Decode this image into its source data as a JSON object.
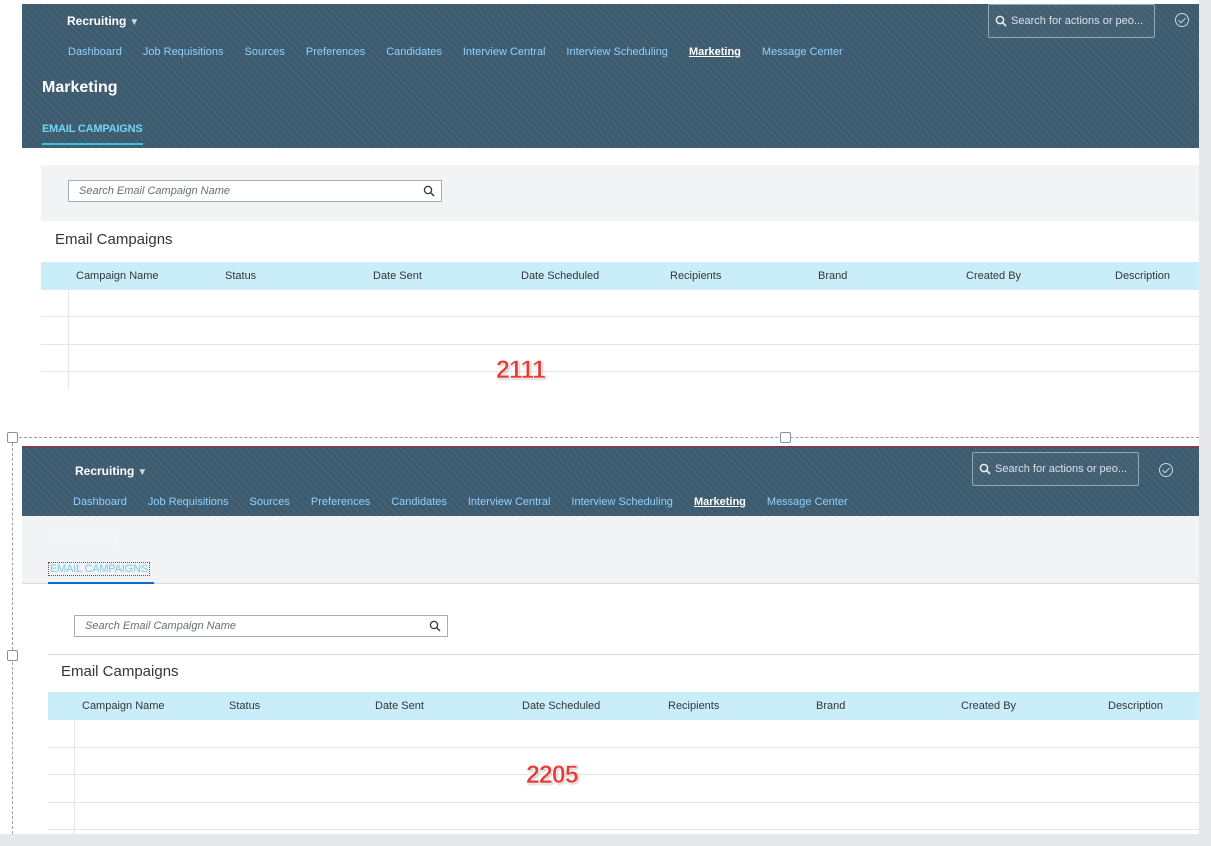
{
  "shots": [
    {
      "app_name": "Recruiting",
      "global_search_placeholder": "Search for actions or peo...",
      "nav": [
        "Dashboard",
        "Job Requisitions",
        "Sources",
        "Preferences",
        "Candidates",
        "Interview Central",
        "Interview Scheduling",
        "Marketing",
        "Message Center"
      ],
      "active_nav": "Marketing",
      "page_title": "Marketing",
      "tab": "EMAIL CAMPAIGNS",
      "search_placeholder": "Search Email Campaign Name",
      "section_title": "Email Campaigns",
      "columns": [
        "Campaign Name",
        "Status",
        "Date Sent",
        "Date Scheduled",
        "Recipients",
        "Brand",
        "Created By",
        "Description"
      ],
      "annotation": "2111"
    },
    {
      "app_name": "Recruiting",
      "global_search_placeholder": "Search for actions or peo...",
      "nav": [
        "Dashboard",
        "Job Requisitions",
        "Sources",
        "Preferences",
        "Candidates",
        "Interview Central",
        "Interview Scheduling",
        "Marketing",
        "Message Center"
      ],
      "active_nav": "Marketing",
      "page_title": "Marketing",
      "tab": "EMAIL CAMPAIGNS",
      "search_placeholder": "Search Email Campaign Name",
      "section_title": "Email Campaigns",
      "columns": [
        "Campaign Name",
        "Status",
        "Date Sent",
        "Date Scheduled",
        "Recipients",
        "Brand",
        "Created By",
        "Description"
      ],
      "annotation": "2205"
    }
  ],
  "colors": {
    "header_bg": "#3d5b6f",
    "nav_link": "#8ed1ff",
    "table_header": "#c9eefa",
    "annotation": "#e63b34"
  }
}
